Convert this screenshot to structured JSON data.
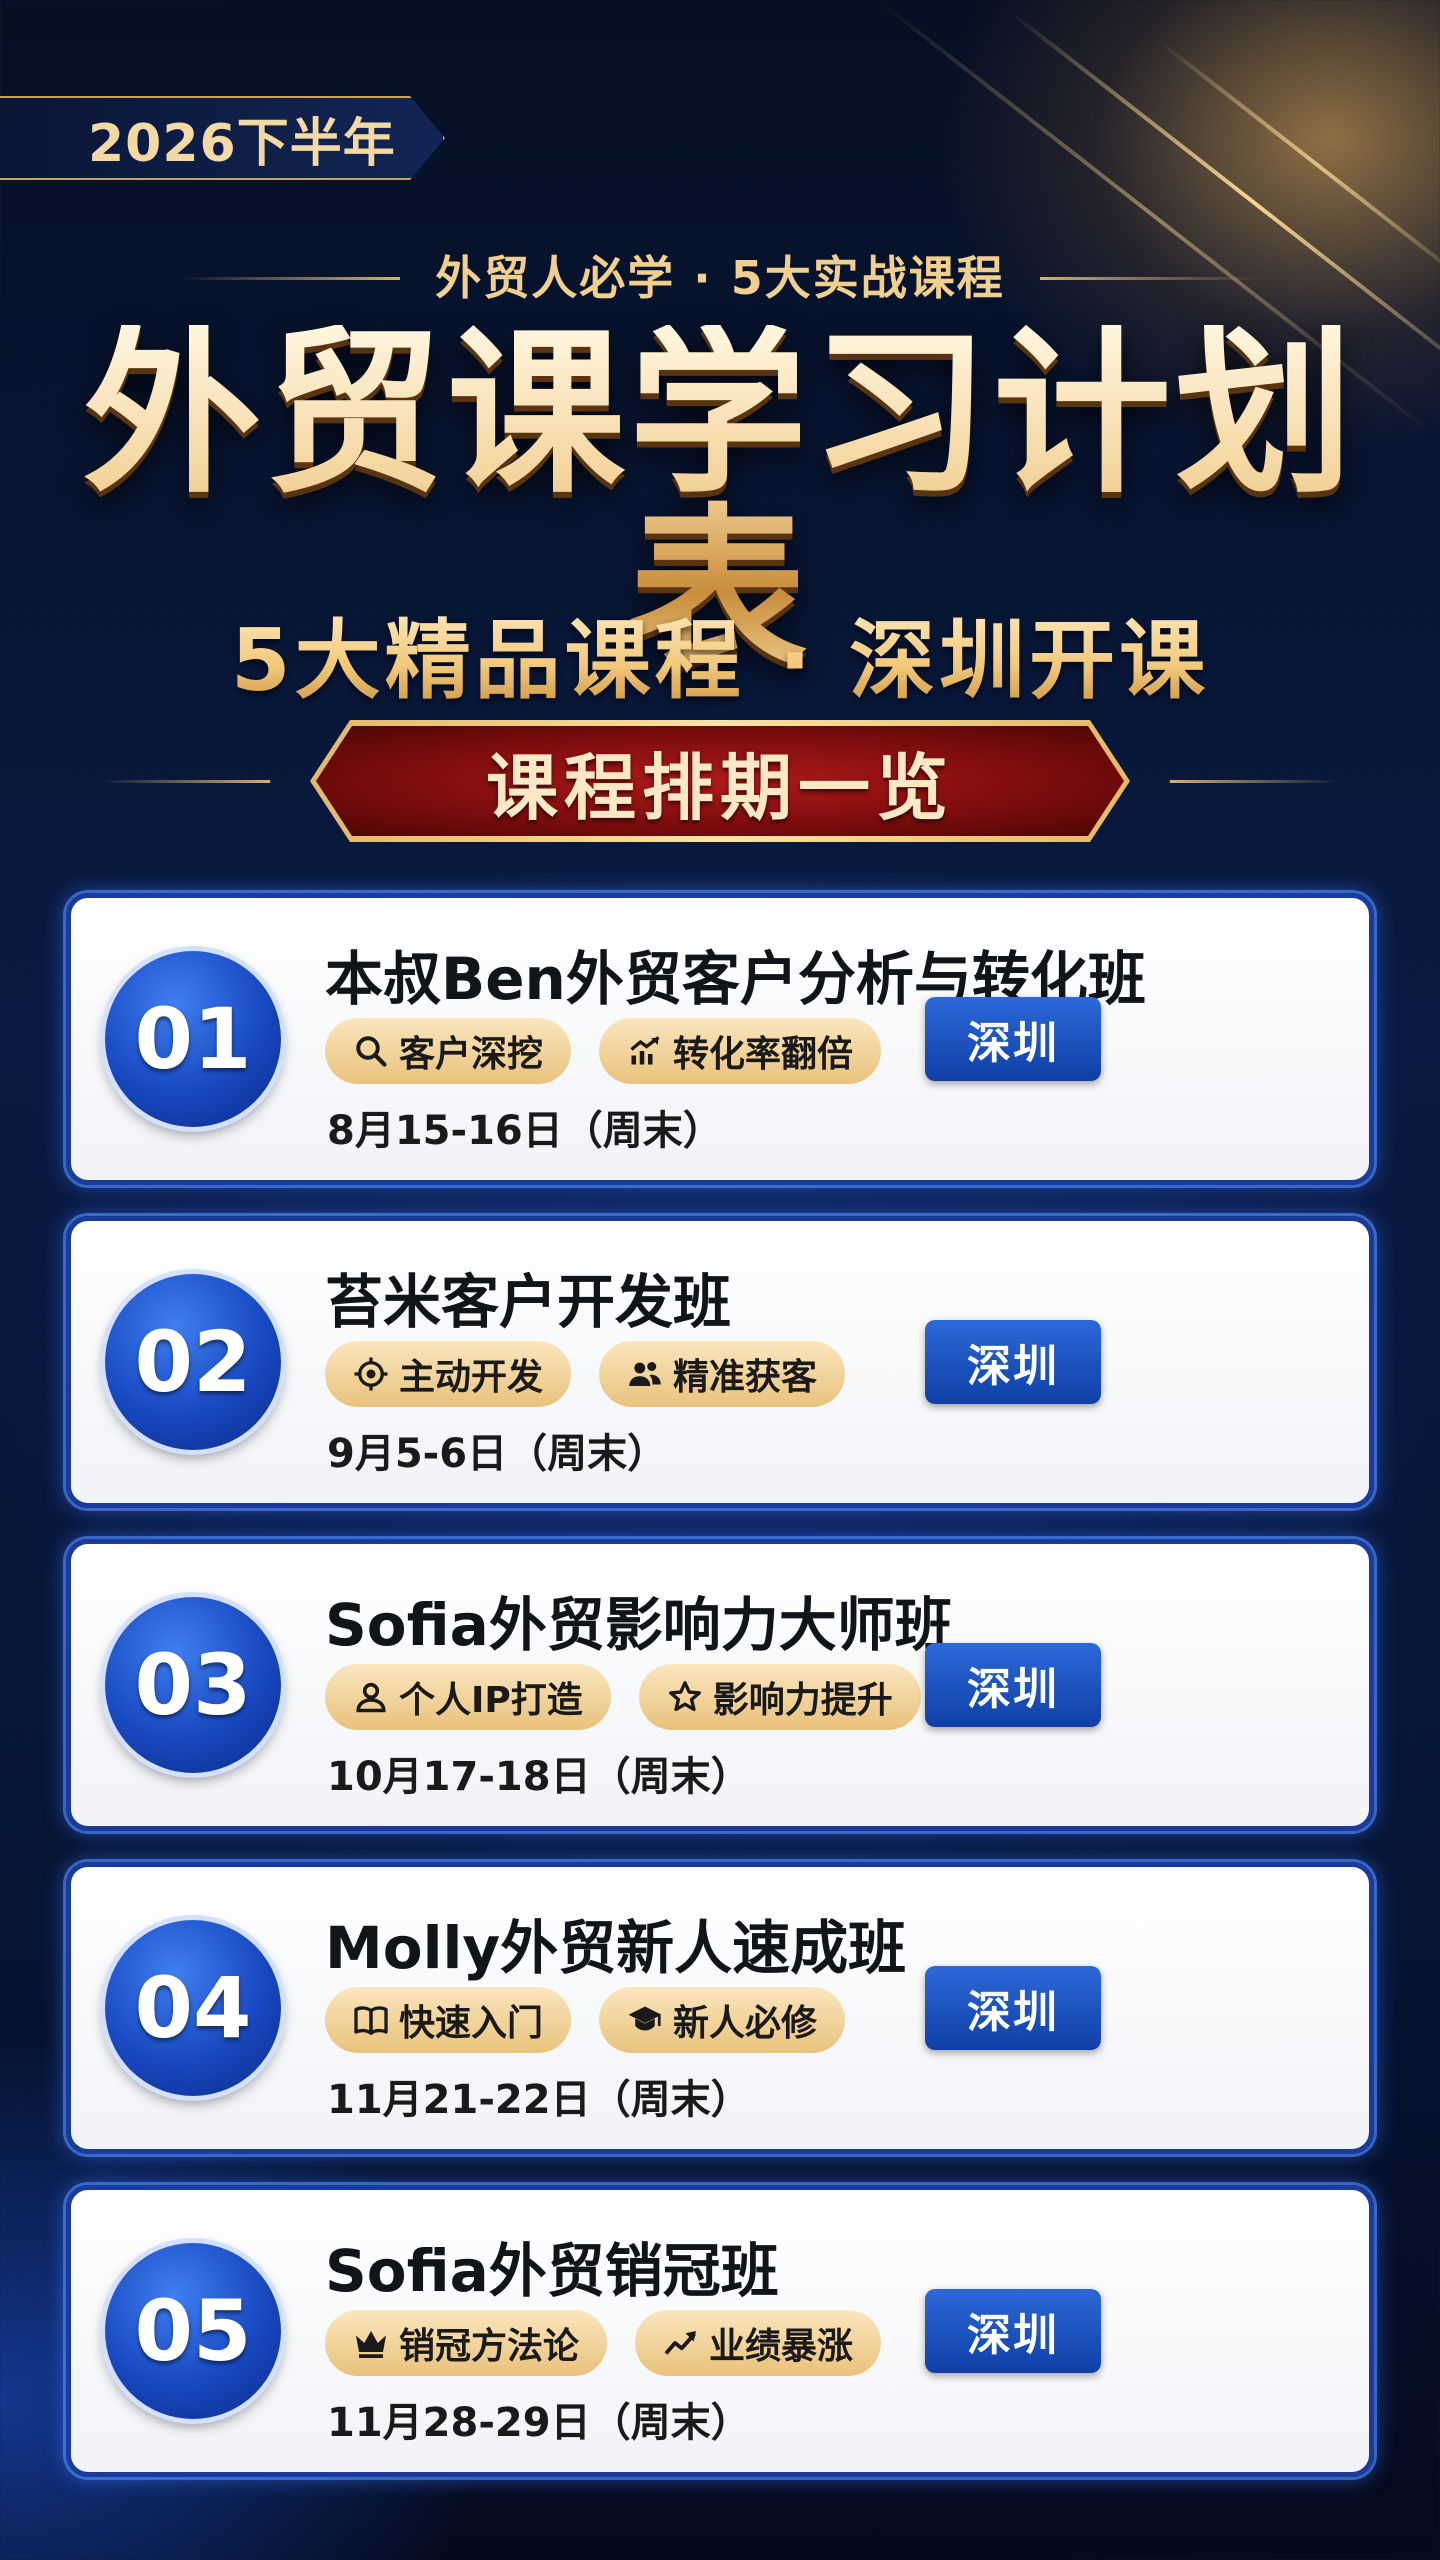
{
  "header": {
    "year_badge": "2026下半年",
    "tagline": "外贸人必学 · 5大实战课程",
    "main_title": "外贸课学习计划表",
    "subtitle": "5大精品课程 · 深圳开课",
    "section_banner": "课程排期一览"
  },
  "colors": {
    "gold": "#f0cf8f",
    "navy": "#0a1a42",
    "banner_red": "#9a1212",
    "card_border_blue": "#1a3b9a",
    "city_button_blue": "#1a4fc0"
  },
  "courses": [
    {
      "number": "01",
      "title": "本叔Ben外贸客户分析与转化班",
      "tags": [
        {
          "icon": "search-icon",
          "label": "客户深挖"
        },
        {
          "icon": "chart-up-icon",
          "label": "转化率翻倍"
        }
      ],
      "date": "8月15-16日（周末）",
      "city": "深圳"
    },
    {
      "number": "02",
      "title": "苔米客户开发班",
      "tags": [
        {
          "icon": "target-icon",
          "label": "主动开发"
        },
        {
          "icon": "users-icon",
          "label": "精准获客"
        }
      ],
      "date": "9月5-6日（周末）",
      "city": "深圳"
    },
    {
      "number": "03",
      "title": "Sofia外贸影响力大师班",
      "tags": [
        {
          "icon": "person-icon",
          "label": "个人IP打造"
        },
        {
          "icon": "star-icon",
          "label": "影响力提升"
        }
      ],
      "date": "10月17-18日（周末）",
      "city": "深圳"
    },
    {
      "number": "04",
      "title": "Molly外贸新人速成班",
      "tags": [
        {
          "icon": "book-icon",
          "label": "快速入门"
        },
        {
          "icon": "graduation-cap-icon",
          "label": "新人必修"
        }
      ],
      "date": "11月21-22日（周末）",
      "city": "深圳"
    },
    {
      "number": "05",
      "title": "Sofia外贸销冠班",
      "tags": [
        {
          "icon": "crown-icon",
          "label": "销冠方法论"
        },
        {
          "icon": "trend-up-icon",
          "label": "业绩暴涨"
        }
      ],
      "date": "11月28-29日（周末）",
      "city": "深圳"
    }
  ]
}
